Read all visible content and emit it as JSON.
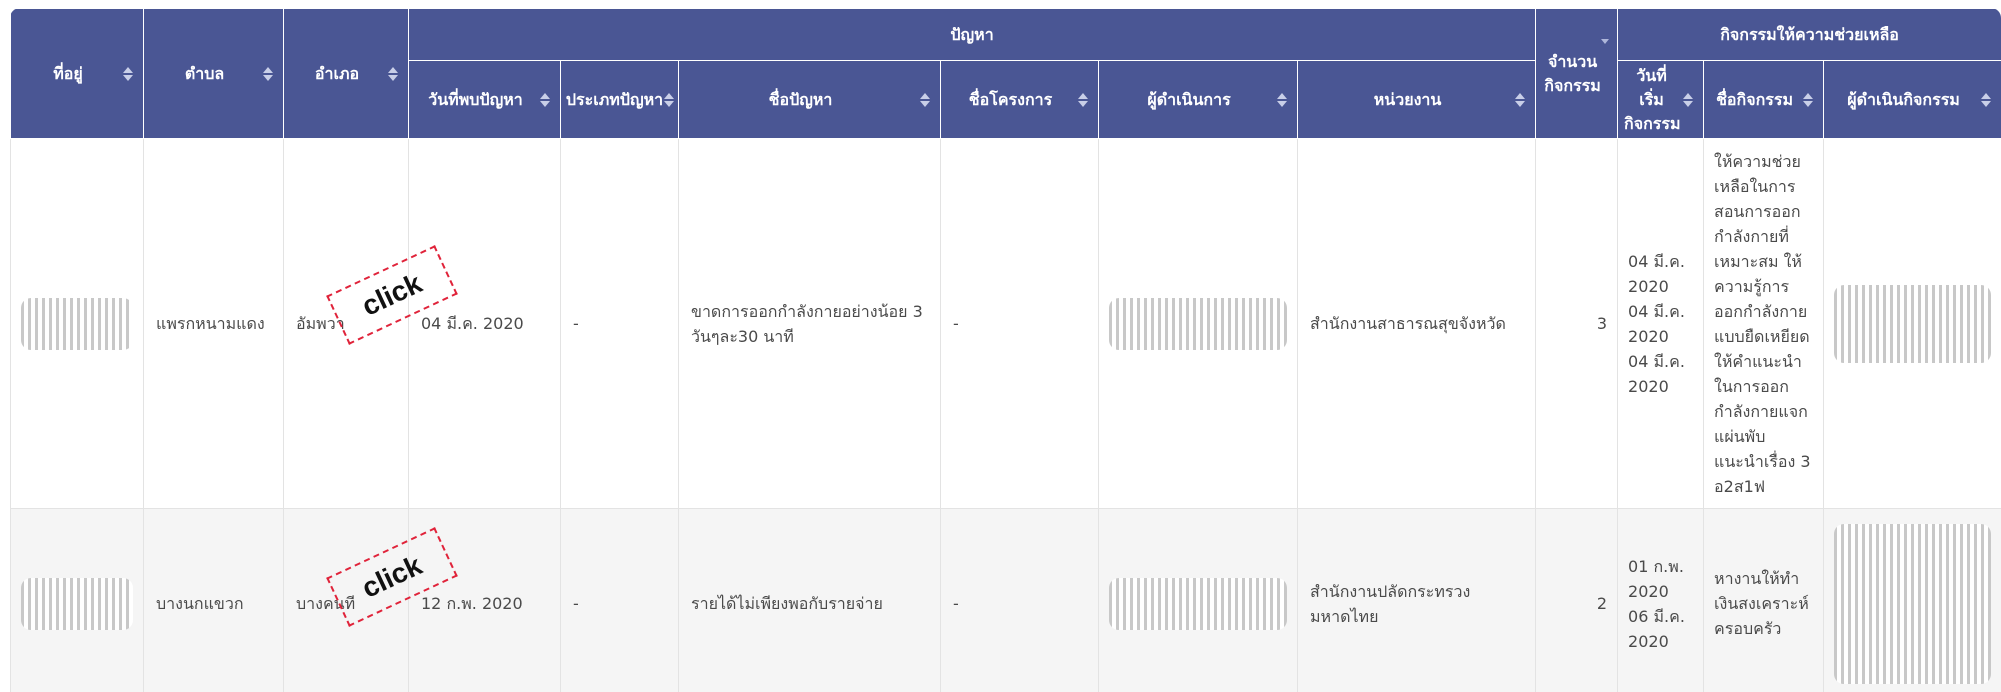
{
  "headers": {
    "address": "ที่อยู่",
    "subdistrict": "ตำบล",
    "district": "อำเภอ",
    "problem_group": "ปัญหา",
    "found_date": "วันที่พบปัญหา",
    "problem_type": "ประเภทปัญหา",
    "problem_name": "ชื่อปัญหา",
    "project_name": "ชื่อโครงการ",
    "operator": "ผู้ดำเนินการ",
    "agency": "หน่วยงาน",
    "activity_count": "จำนวนกิจกรรม",
    "activity_group": "กิจกรรมให้ความช่วยเหลือ",
    "start_date": "วันที่เริ่มกิจกรรม",
    "activity_name": "ชื่อกิจกรรม",
    "activity_operator": "ผู้ดำเนินกิจกรรม"
  },
  "rows": [
    {
      "subdistrict": "แพรกหนามแดง",
      "district": "อัมพวา",
      "found_date": "04 มี.ค. 2020",
      "problem_type": "-",
      "problem_name": "ขาดการออกกำลังกายอย่างน้อย 3 วันๆละ30 นาที",
      "project_name": "-",
      "agency": "สำนักงานสาธารณสุขจังหวัด",
      "activity_count": "3",
      "start_dates": "04 มี.ค. 2020 04 มี.ค. 2020 04 มี.ค. 2020",
      "activity_names": "ให้ความช่วยเหลือในการสอนการออกกำลังกายที่เหมาะสม ให้ความรู้การออกกำลังกายแบบยืดเหยียด ให้คำแนะนำในการออกกำลังกายแจกแผ่นพับ แนะนำเรื่อง 3 อ2ส1ฟ"
    },
    {
      "subdistrict": "บางนกแขวก",
      "district": "บางคนที",
      "found_date": "12 ก.พ. 2020",
      "problem_type": "-",
      "problem_name": "รายได้ไม่เพียงพอกับรายจ่าย",
      "project_name": "-",
      "agency": "สำนักงานปลัดกระทรวงมหาดไทย",
      "activity_count": "2",
      "start_dates": "01 ก.พ. 2020 06 มี.ค. 2020",
      "activity_names": "หางานให้ทำ เงินสงเคราะห์ครอบครัว"
    }
  ],
  "overlay": {
    "stamp_label": "click"
  },
  "colors": {
    "header_bg": "#4a5694",
    "row_alt_bg": "#f5f5f5",
    "stamp_border": "#e0233a"
  }
}
